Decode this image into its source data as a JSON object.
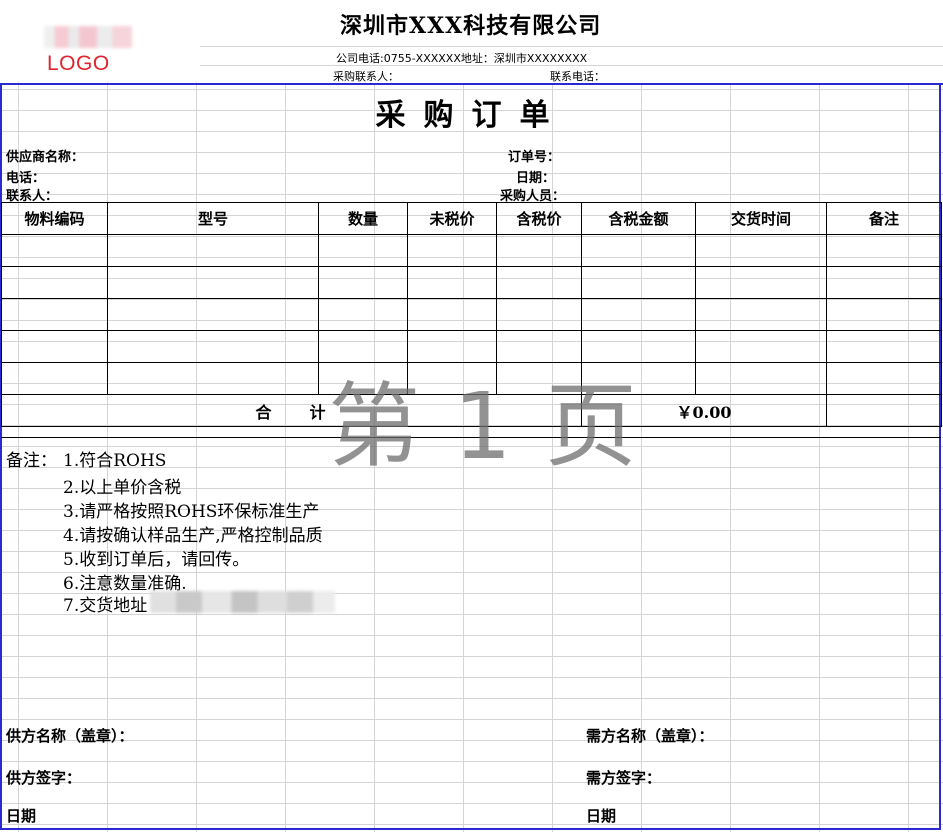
{
  "header": {
    "logo_text": "LOGO",
    "company_name": "深圳市XXX科技有限公司",
    "contact_line": "公司电话:0755-XXXXXX地址：深圳市XXXXXXXX",
    "buyer_contact_label": "采购联系人：",
    "phone_label": "联系电话："
  },
  "title": "采购订单",
  "info": {
    "supplier_label": "供应商名称：",
    "tel_label": "电话：",
    "contact_label": "联系人：",
    "order_no_label": "订单号：",
    "date_label": "日期：",
    "purchaser_label": "采购人员："
  },
  "table": {
    "columns": [
      "物料编码",
      "型号",
      "数量",
      "未税价",
      "含税价",
      "含税金额",
      "交货时间",
      "备注"
    ],
    "rows": [
      [
        "",
        "",
        "",
        "",
        "",
        "",
        "",
        ""
      ],
      [
        "",
        "",
        "",
        "",
        "",
        "",
        "",
        ""
      ],
      [
        "",
        "",
        "",
        "",
        "",
        "",
        "",
        ""
      ],
      [
        "",
        "",
        "",
        "",
        "",
        "",
        "",
        ""
      ],
      [
        "",
        "",
        "",
        "",
        "",
        "",
        "",
        ""
      ]
    ],
    "total_label": "合　　计",
    "total_amount": "￥0.00"
  },
  "watermark": "第 1 页",
  "notes": {
    "label": "备注：",
    "items": [
      "1.符合ROHS",
      "2.以上单价含税",
      "3.请严格按照ROHS环保标准生产",
      "4.请按确认样品生产,严格控制品质",
      "5.收到订单后，请回传。",
      "6.注意数量准确.",
      "7.交货地址"
    ]
  },
  "signature": {
    "supplier_name_label": "供方名称（盖章）：",
    "buyer_name_label": "需方名称（盖章）：",
    "supplier_sign_label": "供方签字：",
    "buyer_sign_label": "需方签字：",
    "supplier_date_label": "日期",
    "buyer_date_label": "日期"
  }
}
